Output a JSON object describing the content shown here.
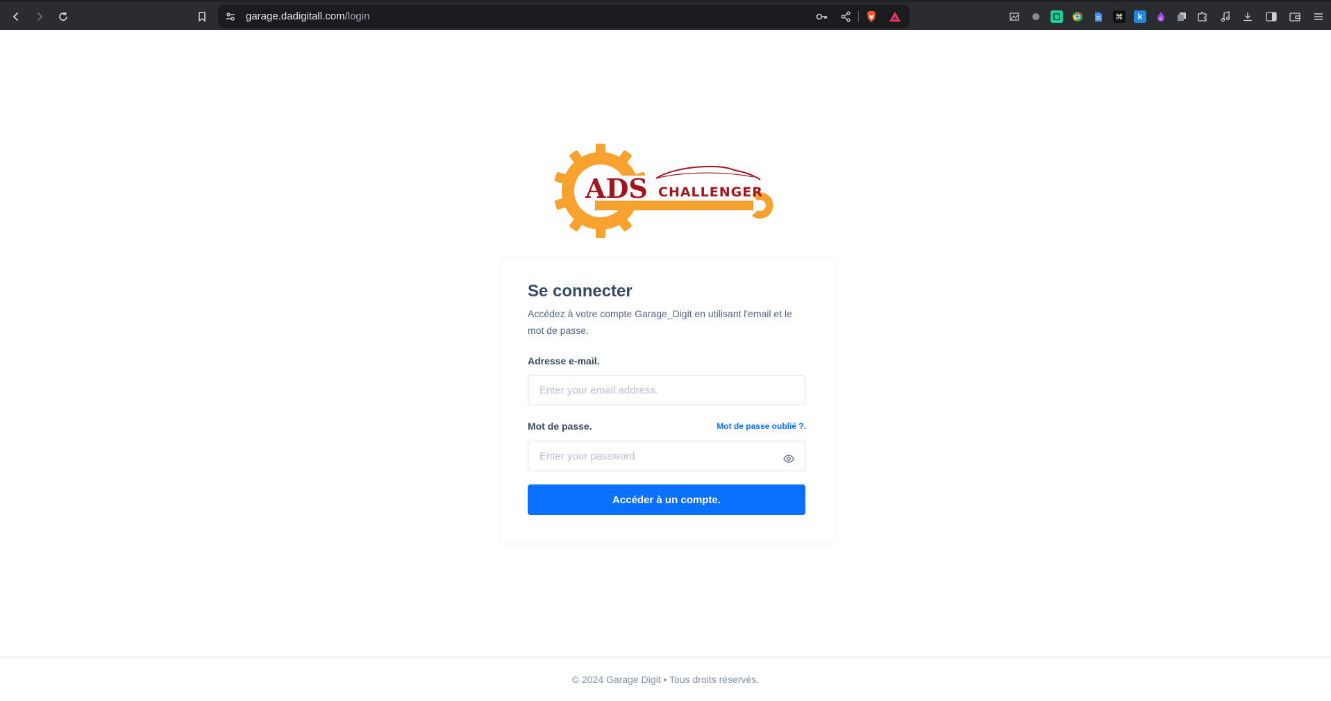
{
  "browser": {
    "url_host": "garage.dadigitall.com",
    "url_path": "/login",
    "nav_icons": [
      "back-icon",
      "forward-icon",
      "reload-icon",
      "bookmark-icon"
    ],
    "toolbar_icons": [
      "site-settings-icon",
      "key-icon",
      "share-icon",
      "brave-shield-icon",
      "brave-rewards-icon"
    ],
    "extension_icons": [
      "image-icon",
      "circle-ext-icon",
      "ext-green-icon",
      "chrome-icon",
      "doc-icon",
      "command-icon",
      "k-icon",
      "flame-icon",
      "copy-icon",
      "puzzle-icon",
      "music-icon",
      "download-icon",
      "sidebar-icon",
      "wallet-icon",
      "menu-icon"
    ]
  },
  "logo": {
    "word1": "ADS",
    "word2": "CHALLENGER",
    "colors": {
      "gear": "#f7a12f",
      "text": "#a3161f"
    }
  },
  "login": {
    "title": "Se connecter",
    "subtitle": "Accédez à votre compte Garage_Digit en utilisant l'email et le mot de passe.",
    "email_label": "Adresse e-mail.",
    "email_placeholder": "Enter your email address.",
    "password_label": "Mot de passe.",
    "forgot_link": "Mot de passe oublié ?.",
    "password_placeholder": "Enter your password",
    "submit_label": "Accéder à un compte."
  },
  "footer": {
    "copyright": "© 2024 Garage Digit • Tous droits réservés."
  },
  "colors": {
    "primary": "#0971fe",
    "heading": "#364a63",
    "body_text": "#526484"
  }
}
